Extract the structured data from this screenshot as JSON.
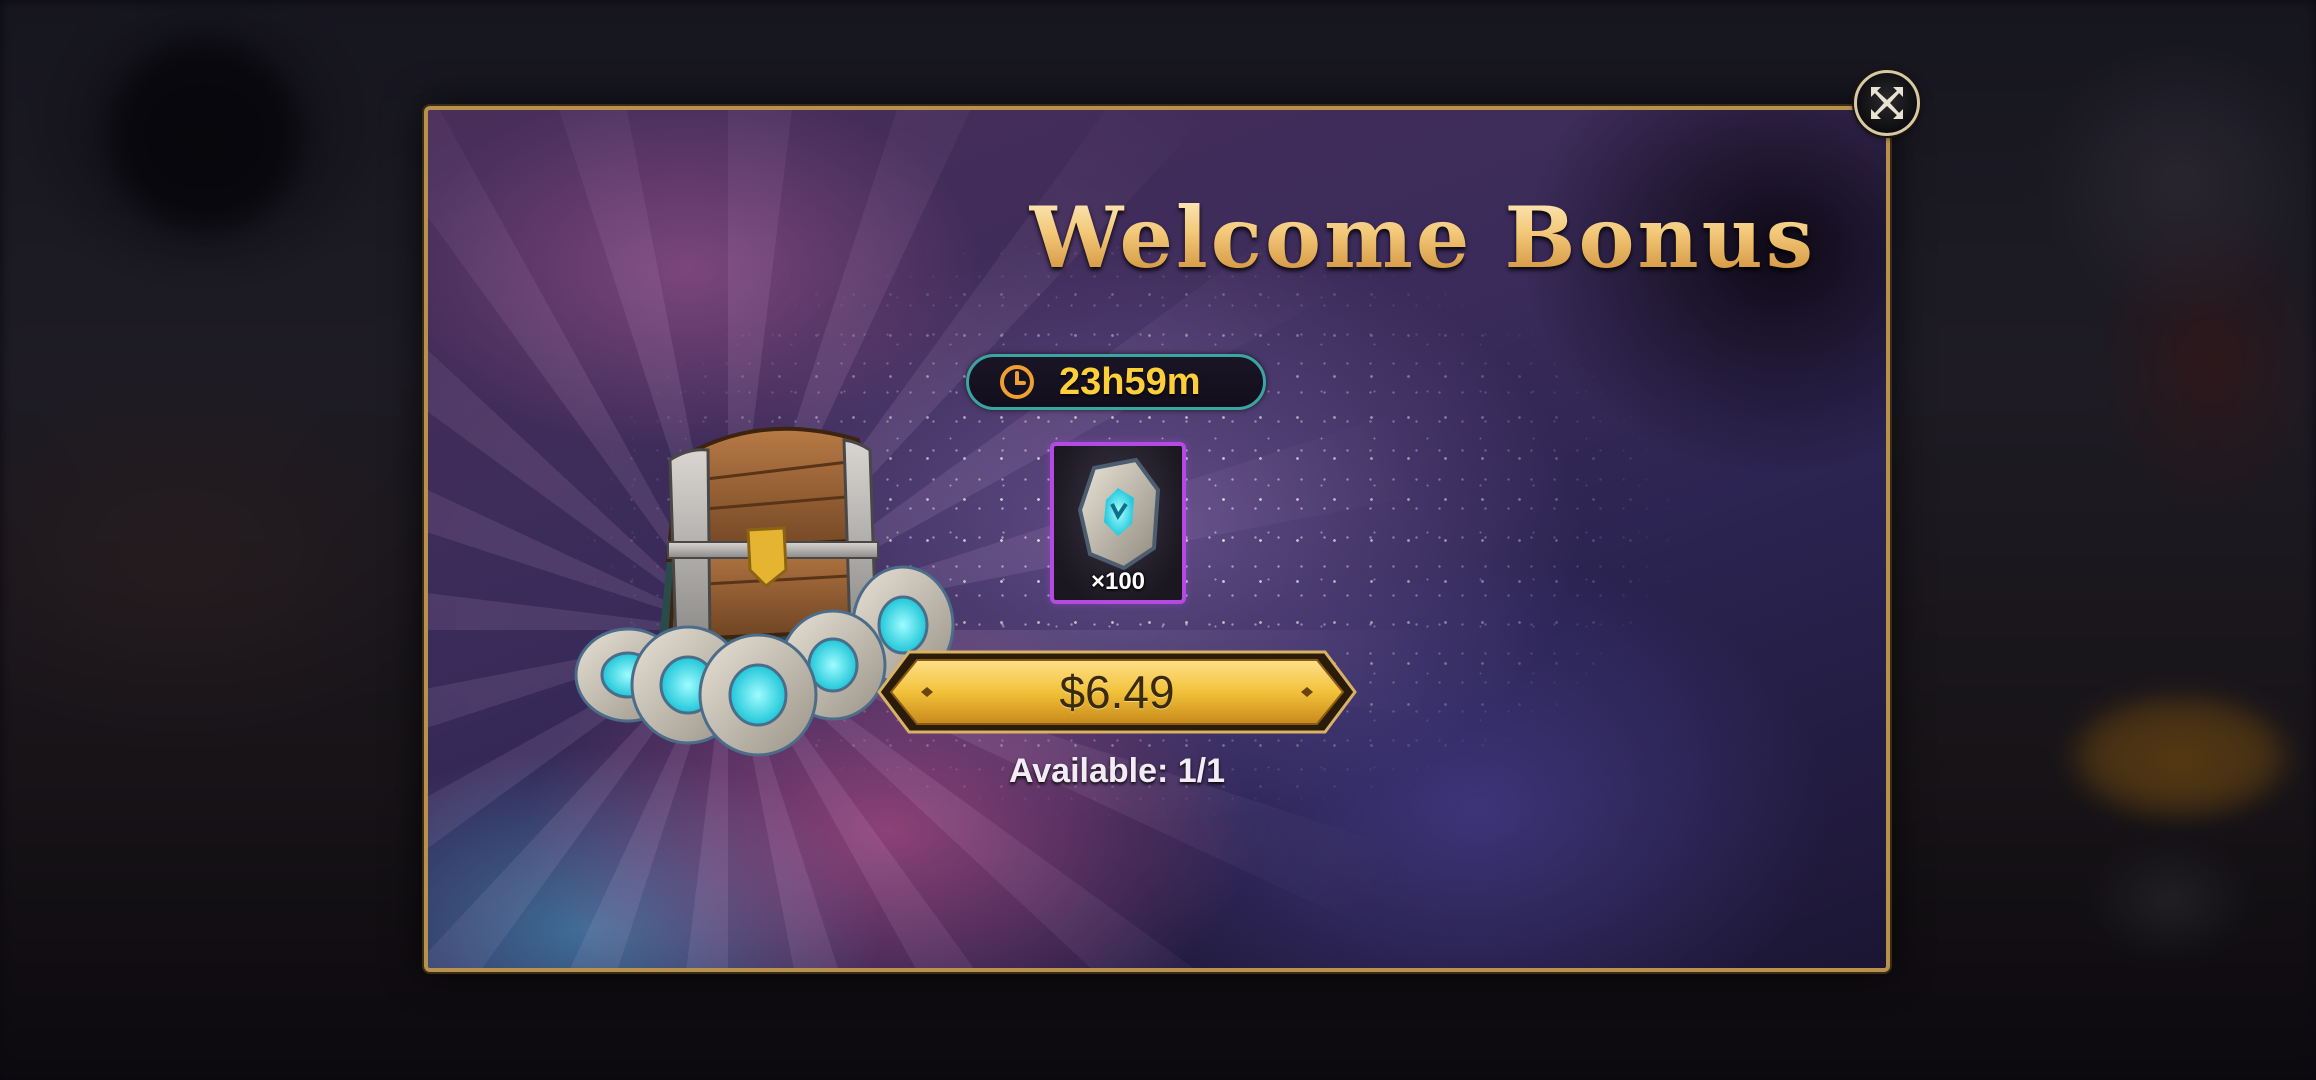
{
  "dialog": {
    "title": "Welcome Bonus",
    "timer": "23h59m",
    "reward": {
      "icon": "rune-stone-icon",
      "quantity": "×100"
    },
    "price": "$6.49",
    "availability": "Available: 1/1"
  },
  "colors": {
    "frame_gold": "#b8924c",
    "title_gold": "#f3c878",
    "timer_text": "#ffcf3a",
    "timer_border": "#3aa6a0",
    "item_border": "#b44be0",
    "button_gold": "#f2c23a"
  }
}
